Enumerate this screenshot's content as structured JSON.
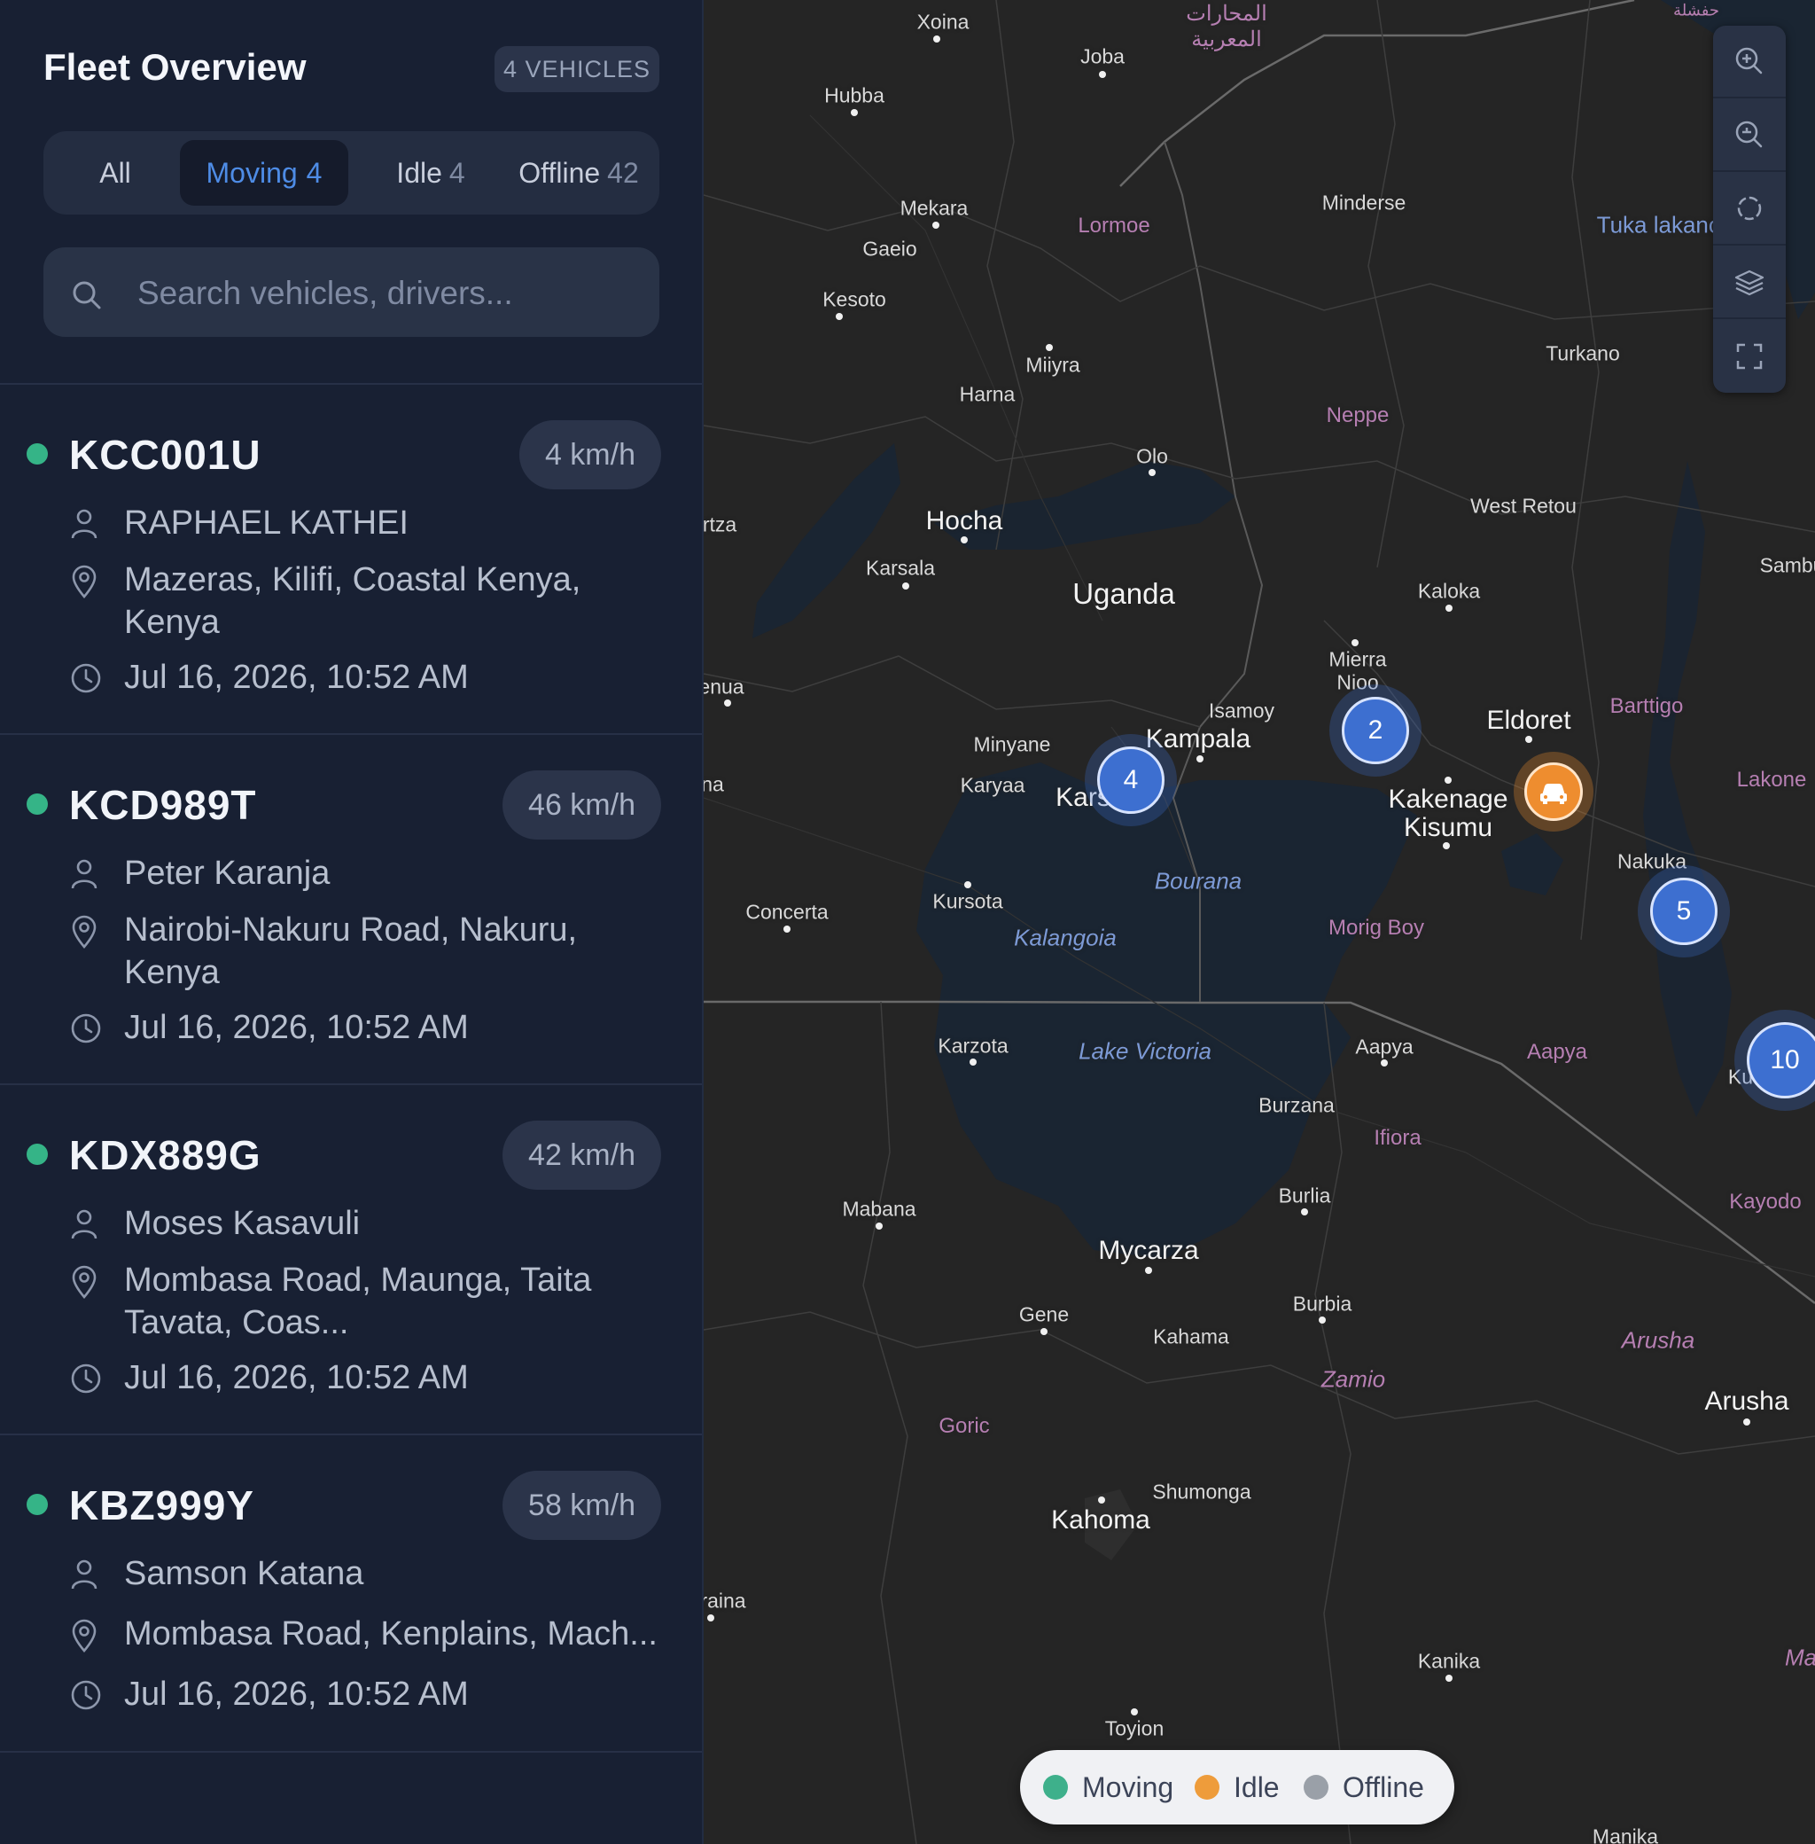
{
  "sidebar": {
    "title": "Fleet Overview",
    "vehicle_count": "4 VEHICLES",
    "tabs": [
      {
        "label": "All",
        "count": ""
      },
      {
        "label": "Moving",
        "count": "4"
      },
      {
        "label": "Idle",
        "count": "4"
      },
      {
        "label": "Offline",
        "count": "42"
      }
    ],
    "active_tab": "Moving",
    "search": {
      "value": "",
      "placeholder": "Search vehicles, drivers..."
    }
  },
  "vehicles": [
    {
      "plate": "KCC001U",
      "speed": "4 km/h",
      "driver": "RAPHAEL KATHEI",
      "location": "Mazeras, Kilifi, Coastal Kenya, Kenya",
      "time": "Jul 16, 2026, 10:52 AM",
      "status": "moving"
    },
    {
      "plate": "KCD989T",
      "speed": "46 km/h",
      "driver": "Peter Karanja",
      "location": "Nairobi-Nakuru Road, Nakuru, Kenya",
      "time": "Jul 16, 2026, 10:52 AM",
      "status": "moving"
    },
    {
      "plate": "KDX889G",
      "speed": "42 km/h",
      "driver": "Moses Kasavuli",
      "location": "Mombasa Road, Maunga, Taita Tavata, Coas...",
      "time": "Jul 16, 2026, 10:52 AM",
      "status": "moving"
    },
    {
      "plate": "KBZ999Y",
      "speed": "58 km/h",
      "driver": "Samson Katana",
      "location": "Mombasa Road, Kenplains, Mach...",
      "time": "Jul 16, 2026, 10:52 AM",
      "status": "moving"
    }
  ],
  "map": {
    "places": {
      "xoina": "Xoina",
      "joba": "Joba",
      "arabic": "المحارات المعربية",
      "arabic_corner": "حفشلة",
      "hubba": "Hubba",
      "mekara": "Mekara",
      "gaeio": "Gaeio",
      "lormoe": "Lormoe",
      "minderse": "Minderse",
      "tuka": "Tuka lakano",
      "kesoto": "Kesoto",
      "turkano": "Turkano",
      "miiyra": "Miiyra",
      "harna": "Harna",
      "neppe": "Neppe",
      "olo": "Olo",
      "tza": "rtza",
      "hocha": "Hocha",
      "west_retou": "West Retou",
      "karsala": "Karsala",
      "sambu": "Sambu",
      "uganda": "Uganda",
      "kaloka": "Kaloka",
      "mierra": "Mierra",
      "nioo": "Nioo",
      "enua": "enua",
      "isamoy": "Isamoy",
      "barttigo": "Barttigo",
      "eldoret": "Eldoret",
      "minyane": "Minyane",
      "kampala": "Kampala",
      "na": "na",
      "lakone": "Lakone",
      "karyaa": "Karyaa",
      "kars": "Kars",
      "kakenage": "Kakenage",
      "kisumu": "Kisumu",
      "nakuka": "Nakuka",
      "bourana": "Bourana",
      "concerta": "Concerta",
      "kursota": "Kursota",
      "morig_boy": "Morig Boy",
      "kalangoia": "Kalangoia",
      "karzota": "Karzota",
      "lake_victoria": "Lake Victoria",
      "aapya": "Aapya",
      "aapya_region": "Aapya",
      "ku": "Ku",
      "burzana": "Burzana",
      "ifiora": "Ifiora",
      "mabana": "Mabana",
      "burlia": "Burlia",
      "kayodo": "Kayodo",
      "mycarza": "Mycarza",
      "burbia": "Burbia",
      "gene": "Gene",
      "kahama": "Kahama",
      "arusha_region": "Arusha",
      "zamio": "Zamio",
      "arusha": "Arusha",
      "goric": "Goric",
      "shumonga": "Shumonga",
      "kahoma": "Kahoma",
      "raina": "raina",
      "kanika": "Kanika",
      "ma": "Ma",
      "toyion": "Toyion",
      "manika": "Manika"
    },
    "clusters": [
      {
        "label": "4"
      },
      {
        "label": "2"
      },
      {
        "label": "5"
      },
      {
        "label": "10"
      }
    ],
    "controls": [
      "zoom-in",
      "zoom-out",
      "locate",
      "layers",
      "fullscreen"
    ],
    "legend": [
      {
        "label": "Moving",
        "color": "#3eb08b"
      },
      {
        "label": "Idle",
        "color": "#ee9c3b"
      },
      {
        "label": "Offline",
        "color": "#9aa0a8"
      }
    ]
  },
  "colors": {
    "moving": "#35b487",
    "idle": "#ee8d2f",
    "accent": "#4e8ce6",
    "cluster": "#3d6fd0"
  }
}
